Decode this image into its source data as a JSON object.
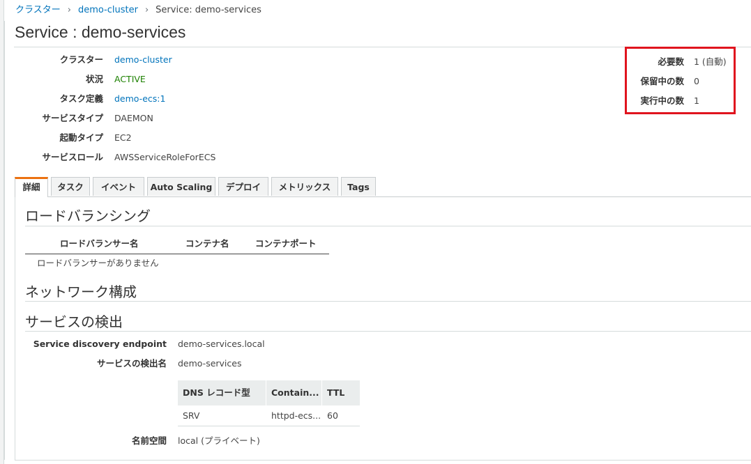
{
  "breadcrumb": {
    "items": [
      "クラスター",
      "demo-cluster"
    ],
    "current": "Service: demo-services",
    "separator": "›"
  },
  "page_title": "Service : demo-services",
  "details": [
    {
      "label": "クラスター",
      "value": "demo-cluster",
      "kind": "link"
    },
    {
      "label": "状況",
      "value": "ACTIVE",
      "kind": "status"
    },
    {
      "label": "タスク定義",
      "value": "demo-ecs:1",
      "kind": "link"
    },
    {
      "label": "サービスタイプ",
      "value": "DAEMON",
      "kind": "text"
    },
    {
      "label": "起動タイプ",
      "value": "EC2",
      "kind": "text"
    },
    {
      "label": "サービスロール",
      "value": "AWSServiceRoleForECS",
      "kind": "text"
    }
  ],
  "counts": [
    {
      "label": "必要数",
      "value": "1 (自動)"
    },
    {
      "label": "保留中の数",
      "value": "0"
    },
    {
      "label": "実行中の数",
      "value": "1"
    }
  ],
  "tabs": [
    {
      "label": "詳細",
      "active": true
    },
    {
      "label": "タスク",
      "active": false
    },
    {
      "label": "イベント",
      "active": false
    },
    {
      "label": "Auto Scaling",
      "active": false
    },
    {
      "label": "デプロイ",
      "active": false
    },
    {
      "label": "メトリックス",
      "active": false
    },
    {
      "label": "Tags",
      "active": false
    }
  ],
  "load_balancing": {
    "heading": "ロードバランシング",
    "columns": [
      "ロードバランサー名",
      "コンテナ名",
      "コンテナポート"
    ],
    "empty_text": "ロードバランサーがありません"
  },
  "network": {
    "heading": "ネットワーク構成"
  },
  "service_discovery": {
    "heading": "サービスの検出",
    "endpoint_label": "Service discovery endpoint",
    "endpoint_value": "demo-services.local",
    "name_label": "サービスの検出名",
    "name_value": "demo-services",
    "dns_columns": [
      "DNS レコード型",
      "Contain...",
      "TTL"
    ],
    "dns_rows": [
      [
        "SRV",
        "httpd-ecs...",
        "60"
      ]
    ],
    "namespace_label": "名前空間",
    "namespace_value": "local (プライベート)"
  },
  "colors": {
    "link": "#0073bb",
    "active_status": "#1d8102",
    "tab_accent": "#ec7211",
    "highlight_box": "#e0141e"
  }
}
